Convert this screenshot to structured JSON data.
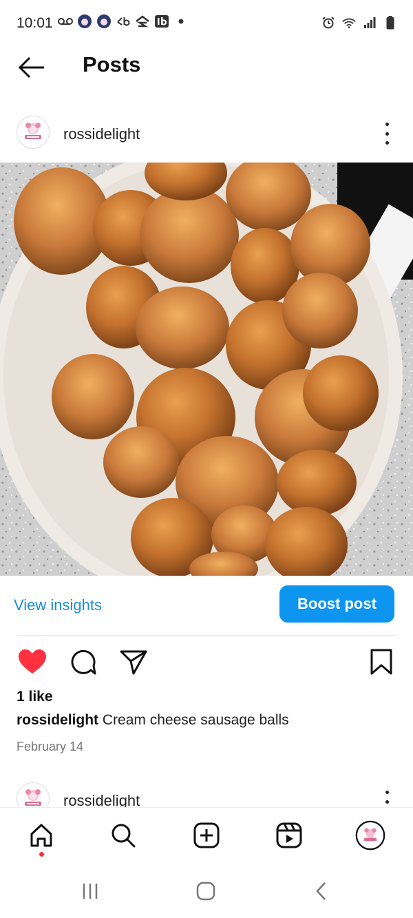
{
  "status_bar": {
    "time": "10:01",
    "left_icons": [
      "voicemail-icon",
      "avatar-icon",
      "avatar-icon",
      "app-icon",
      "zillow-icon",
      "ib-icon",
      "dot-icon"
    ],
    "right_icons": [
      "alarm-icon",
      "wifi-icon",
      "signal-icon",
      "battery-icon"
    ]
  },
  "app_bar": {
    "title": "Posts"
  },
  "post": {
    "username": "rossidelight",
    "caption_user": "rossidelight",
    "caption_text": " Cream cheese sausage balls",
    "likes": "1 like",
    "date": "February 14",
    "view_insights": "View insights",
    "boost": "Boost post"
  },
  "next_post": {
    "username": "rossidelight"
  },
  "colors": {
    "accent": "#0d95f0",
    "link": "#1a8fd8",
    "like": "#ff3040"
  },
  "bottom_nav": [
    "home-icon",
    "search-icon",
    "create-icon",
    "reels-icon",
    "profile-icon"
  ],
  "system_nav": [
    "recents-icon",
    "home-button-icon",
    "back-icon"
  ]
}
